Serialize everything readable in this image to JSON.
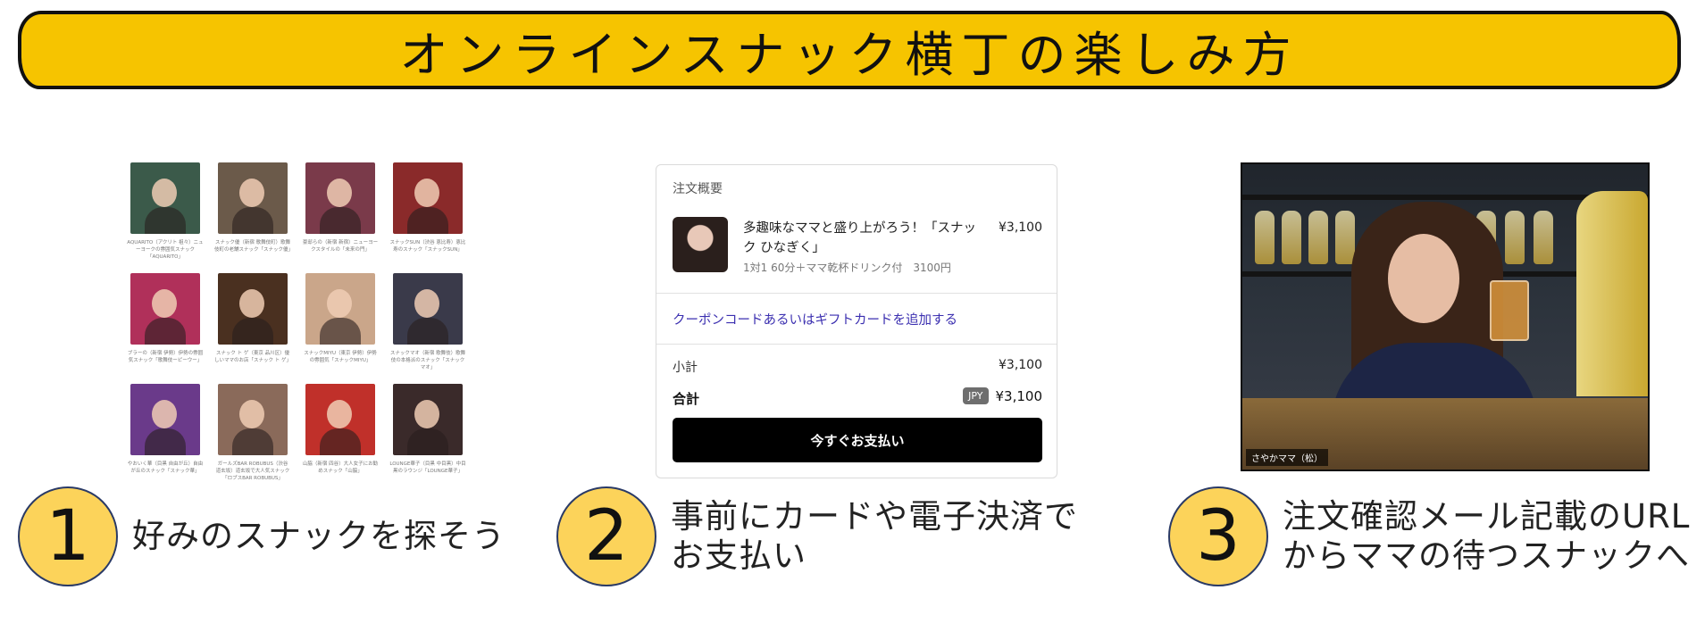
{
  "header": {
    "title": "オンラインスナック横丁の楽しみ方"
  },
  "snacks": [
    {
      "caption": "AQUARITO（アクリト 祖々）ニューヨークの雰囲気スナック「AQUARITO」",
      "color": "#3b5a4a"
    },
    {
      "caption": "スナック優（新宿 歌舞伎町）歌舞伎町の老舗スナック「スナック優」",
      "color": "#6b5a4a"
    },
    {
      "caption": "豪邸らの（新宿 新宿）ニューヨークスタイルの「未来の門」",
      "color": "#7a3a4a"
    },
    {
      "caption": "スナックSUN（渋谷 恵比寿）恵比寿のスナック「スナックSUN」",
      "color": "#8a2a2a"
    },
    {
      "caption": "ブラーの（新宿 伊勢）伊勢の雰囲気スナック「歌舞伎ーピーウー」",
      "color": "#b0305a"
    },
    {
      "caption": "スナック ト ゲ（東京 品川区）優しいママのお店「スナック ト ゲ」",
      "color": "#4a3020"
    },
    {
      "caption": "スナックMIYU（東京 伊勢）伊勢の雰囲気「スナックMIYU」",
      "color": "#caa68a"
    },
    {
      "caption": "スナックマオ（新宿 歌舞伎）歌舞伎の本格派のスナック「スナックマオ」",
      "color": "#3a3a4a"
    },
    {
      "caption": "やおいく華（目黒 自由が丘）自由が丘のスナック「スナック華」",
      "color": "#6a3a8a"
    },
    {
      "caption": "ガールズBAR ROBUBUS（渋谷 道玄坂）道玄坂で大人気スナック「ロブスBAR ROBUBUS」",
      "color": "#8a6a5a"
    },
    {
      "caption": "山脇（新宿 四谷）大人女子にお勧めスナック「山脇」",
      "color": "#c0302a"
    },
    {
      "caption": "LOUNGE華子（目黒 中目黒）中目黒のラウンジ「LOUNGE華子」",
      "color": "#3a2a2a"
    }
  ],
  "order": {
    "heading": "注文概要",
    "product_name": "多趣味なママと盛り上がろう！「スナック ひなぎく」",
    "product_desc": "1対1 60分＋ママ乾杯ドリンク付　3100円",
    "product_price": "¥3,100",
    "coupon_link": "クーポンコードあるいはギフトカードを追加する",
    "subtotal_label": "小計",
    "subtotal_value": "¥3,100",
    "total_label": "合計",
    "currency": "JPY",
    "total_value": "¥3,100",
    "pay_button": "今すぐお支払い"
  },
  "video": {
    "name_tag": "さやかママ（松）"
  },
  "steps": [
    {
      "number": "1",
      "lines": [
        "好みのスナックを探そう"
      ]
    },
    {
      "number": "2",
      "lines": [
        "事前にカードや電子決済で",
        "お支払い"
      ]
    },
    {
      "number": "3",
      "lines": [
        "注文確認メール記載のURL",
        "からママの待つスナックへ"
      ]
    }
  ],
  "colors": {
    "banner": "#f6c400",
    "step_circle": "#fcd35a",
    "link": "#3b2fb0"
  }
}
